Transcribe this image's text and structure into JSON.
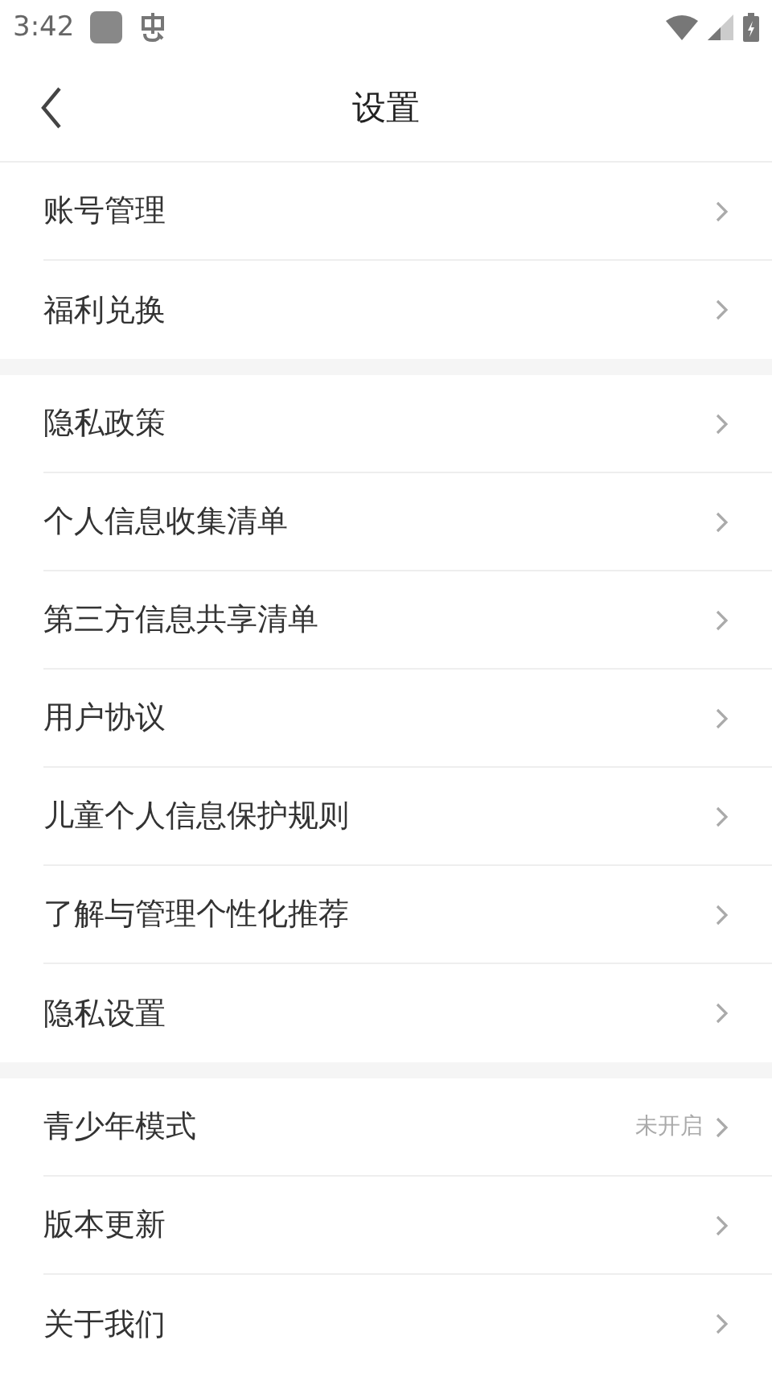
{
  "status_bar": {
    "time": "3:42"
  },
  "header": {
    "title": "设置"
  },
  "sections": [
    {
      "items": [
        {
          "label": "账号管理"
        },
        {
          "label": "福利兑换"
        }
      ]
    },
    {
      "items": [
        {
          "label": "隐私政策"
        },
        {
          "label": "个人信息收集清单"
        },
        {
          "label": "第三方信息共享清单"
        },
        {
          "label": "用户协议"
        },
        {
          "label": "儿童个人信息保护规则"
        },
        {
          "label": "了解与管理个性化推荐"
        },
        {
          "label": "隐私设置"
        }
      ]
    },
    {
      "items": [
        {
          "label": "青少年模式",
          "value": "未开启"
        },
        {
          "label": "版本更新"
        },
        {
          "label": "关于我们"
        }
      ]
    }
  ]
}
